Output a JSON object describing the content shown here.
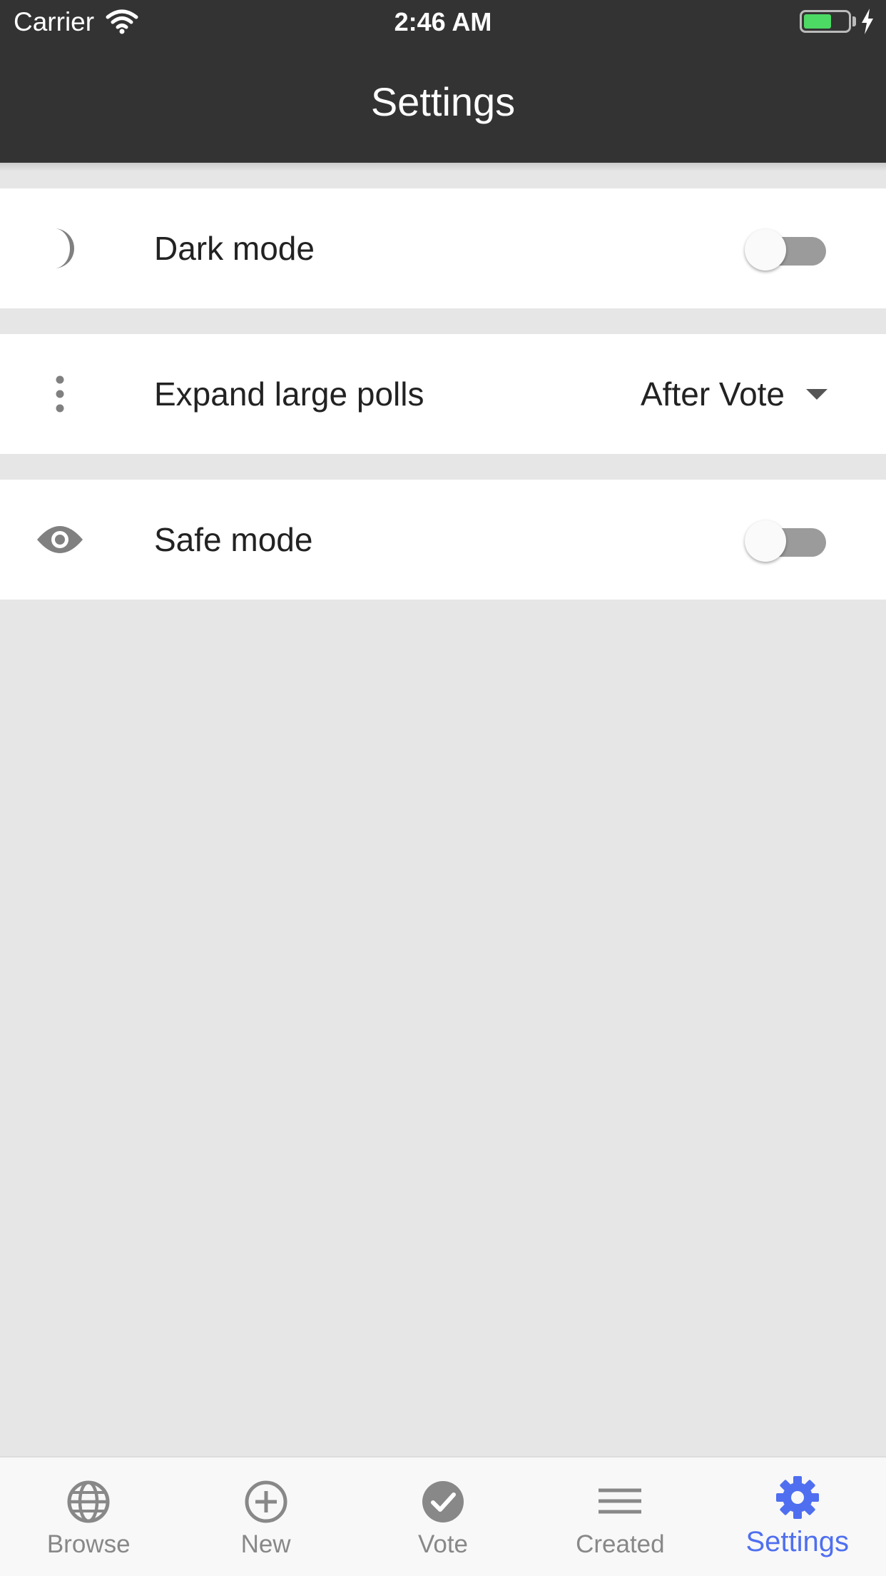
{
  "status_bar": {
    "carrier": "Carrier",
    "time": "2:46 AM",
    "battery_color": "#4cd964"
  },
  "header": {
    "title": "Settings",
    "background": "#333333"
  },
  "settings": {
    "dark_mode": {
      "label": "Dark mode",
      "icon": "moon-icon",
      "enabled": false
    },
    "expand_large_polls": {
      "label": "Expand large polls",
      "icon": "more-vertical-icon",
      "value": "After Vote"
    },
    "safe_mode": {
      "label": "Safe mode",
      "icon": "eye-icon",
      "enabled": false
    }
  },
  "tabs": [
    {
      "label": "Browse",
      "icon": "globe-icon",
      "active": false
    },
    {
      "label": "New",
      "icon": "add-circle-icon",
      "active": false
    },
    {
      "label": "Vote",
      "icon": "check-circle-icon",
      "active": false
    },
    {
      "label": "Created",
      "icon": "list-icon",
      "active": false
    },
    {
      "label": "Settings",
      "icon": "gear-icon",
      "active": true
    }
  ],
  "colors": {
    "active_tab": "#4f6ff0",
    "inactive_tab": "#888888",
    "page_background": "#e6e6e6"
  }
}
